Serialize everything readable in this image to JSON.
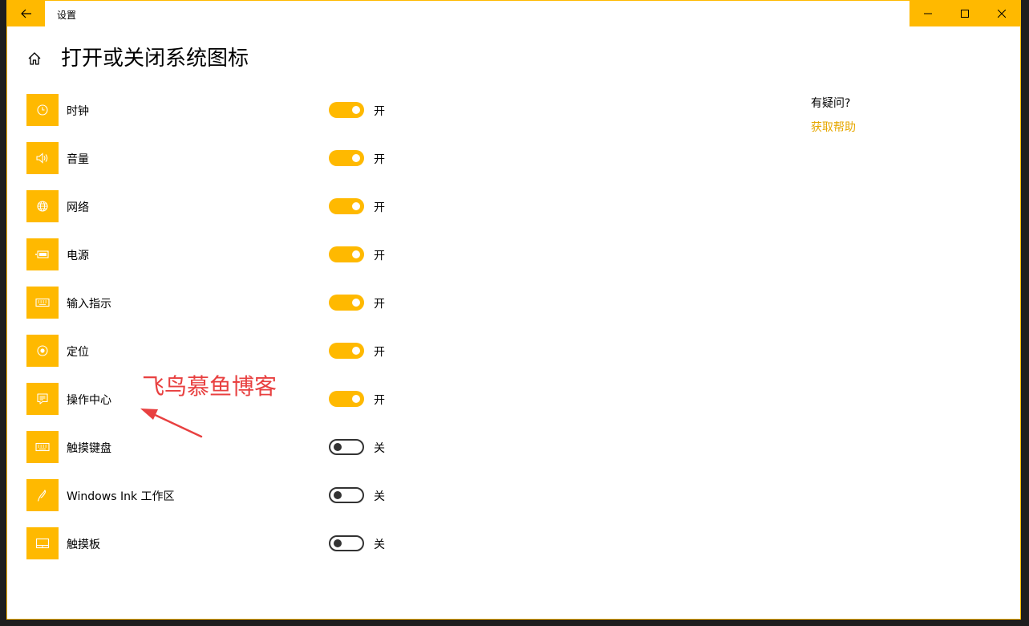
{
  "window": {
    "title": "设置",
    "accent_color": "#ffb900"
  },
  "page": {
    "title": "打开或关闭系统图标"
  },
  "items": [
    {
      "label": "时钟",
      "icon": "clock-icon",
      "state": "开",
      "on": true
    },
    {
      "label": "音量",
      "icon": "volume-icon",
      "state": "开",
      "on": true
    },
    {
      "label": "网络",
      "icon": "globe-icon",
      "state": "开",
      "on": true
    },
    {
      "label": "电源",
      "icon": "battery-icon",
      "state": "开",
      "on": true
    },
    {
      "label": "输入指示",
      "icon": "keyboard-icon",
      "state": "开",
      "on": true
    },
    {
      "label": "定位",
      "icon": "location-icon",
      "state": "开",
      "on": true
    },
    {
      "label": "操作中心",
      "icon": "action-center-icon",
      "state": "开",
      "on": true
    },
    {
      "label": "触摸键盘",
      "icon": "keyboard-icon",
      "state": "关",
      "on": false
    },
    {
      "label": "Windows Ink 工作区",
      "icon": "pen-icon",
      "state": "关",
      "on": false
    },
    {
      "label": "触摸板",
      "icon": "touchpad-icon",
      "state": "关",
      "on": false
    }
  ],
  "help": {
    "question": "有疑问?",
    "link": "获取帮助"
  },
  "overlay": {
    "watermark": "飞鸟慕鱼博客",
    "watermark_color": "#e84040"
  }
}
